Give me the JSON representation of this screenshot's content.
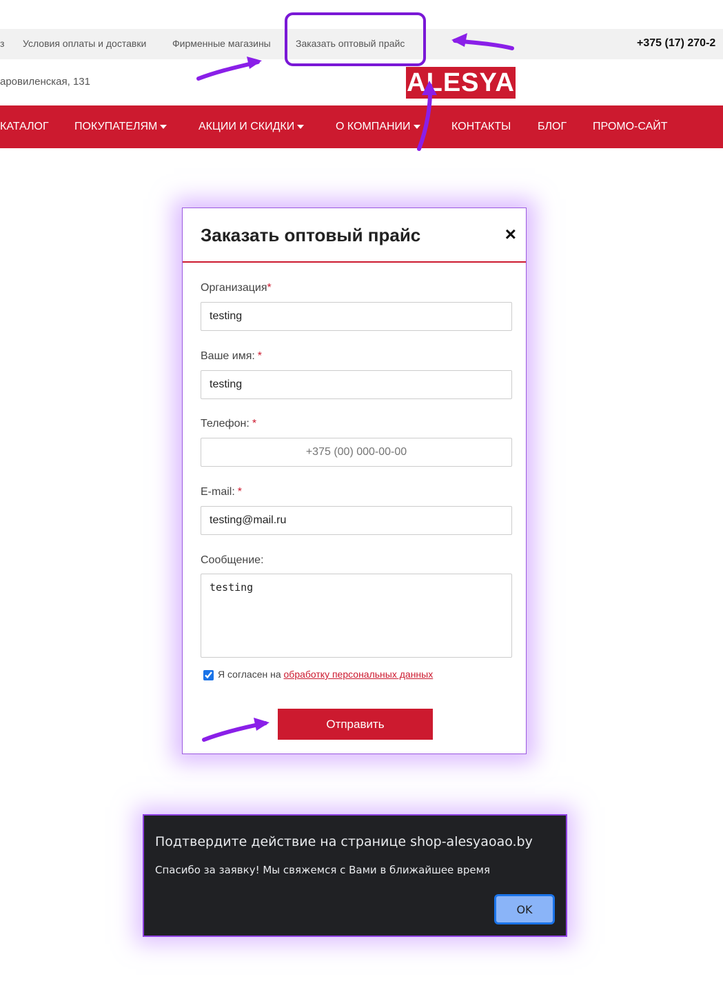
{
  "topbar": {
    "links": [
      "з",
      "Условия оплаты и доставки",
      "Фирменные магазины",
      "Заказать оптовый прайс"
    ],
    "phone": "+375 (17) 270-2"
  },
  "address": "аровиленская, 131",
  "logo": "ALESYA",
  "nav": {
    "items": [
      {
        "label": "КАТАЛОГ",
        "dropdown": false
      },
      {
        "label": "ПОКУПАТЕЛЯМ",
        "dropdown": true
      },
      {
        "label": "АКЦИИ И СКИДКИ",
        "dropdown": true
      },
      {
        "label": "О КОМПАНИИ",
        "dropdown": true
      },
      {
        "label": "КОНТАКТЫ",
        "dropdown": false
      },
      {
        "label": "БЛОГ",
        "dropdown": false
      },
      {
        "label": "ПРОМО-САЙТ",
        "dropdown": false
      }
    ]
  },
  "modal": {
    "title": "Заказать оптовый прайс",
    "close_icon": "×",
    "fields": {
      "organization": {
        "label": "Организация",
        "value": "testing",
        "required": "*"
      },
      "name": {
        "label": "Ваше имя:",
        "value": "testing",
        "required": "*"
      },
      "phone": {
        "label": "Телефон:",
        "placeholder": "+375 (00) 000-00-00",
        "required": "*"
      },
      "email": {
        "label": "E-mail:",
        "value": "testing@mail.ru",
        "required": "*"
      },
      "message": {
        "label": "Сообщение:",
        "value": "testing"
      }
    },
    "consent": {
      "checked": true,
      "text": "Я согласен на",
      "link": "обработку персональных данных"
    },
    "submit_label": "Отправить"
  },
  "dialog": {
    "title": "Подтвердите действие на странице shop-alesyaoao.by",
    "message": "Спасибо за заявку! Мы свяжемся с Вами в ближайшее время",
    "ok_label": "OK"
  },
  "colors": {
    "brand_red": "#cc1a2f",
    "annotation_purple": "#7a18d6",
    "dialog_bg": "#202124",
    "dialog_button": "#8ab4f8"
  }
}
